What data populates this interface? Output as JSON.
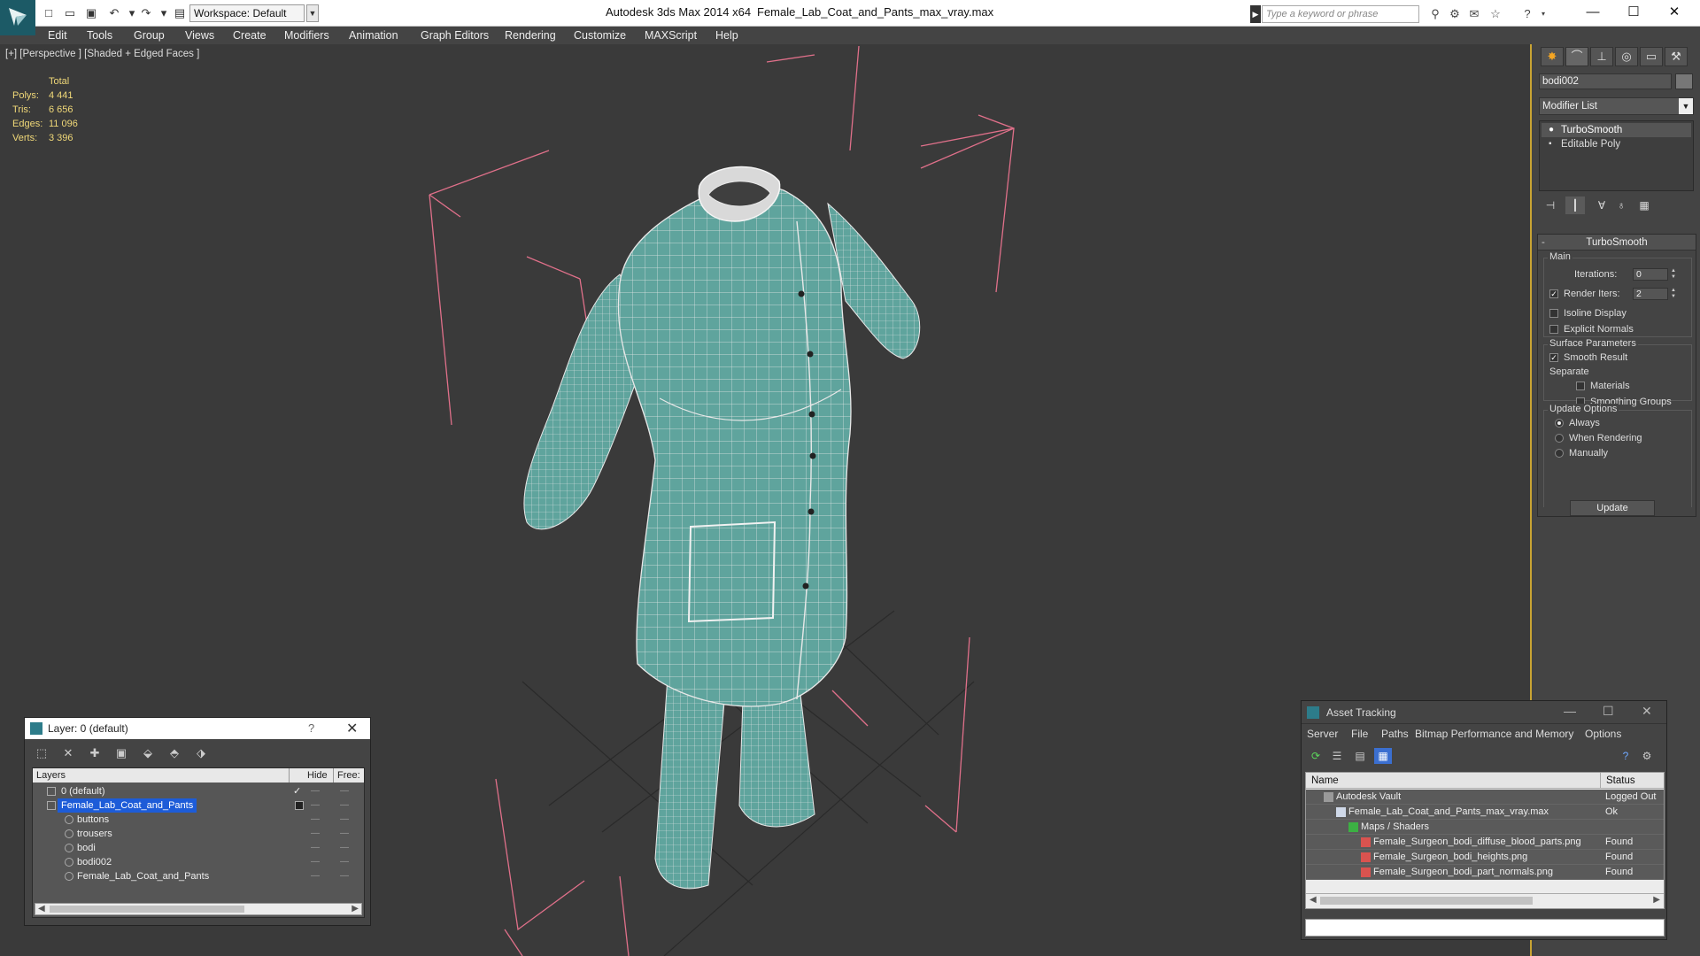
{
  "titlebar": {
    "workspace_label": "Workspace: Default",
    "app_title": "Autodesk 3ds Max  2014 x64",
    "file_title": "Female_Lab_Coat_and_Pants_max_vray.max",
    "search_placeholder": "Type a keyword or phrase"
  },
  "menu": [
    "Edit",
    "Tools",
    "Group",
    "Views",
    "Create",
    "Modifiers",
    "Animation",
    "Graph Editors",
    "Rendering",
    "Customize",
    "MAXScript",
    "Help"
  ],
  "viewport": {
    "label": "[+] [Perspective ] [Shaded + Edged Faces ]",
    "stats": {
      "header": "Total",
      "rows": [
        {
          "label": "Polys:",
          "value": "4 441"
        },
        {
          "label": "Tris:",
          "value": "6 656"
        },
        {
          "label": "Edges:",
          "value": "11 096"
        },
        {
          "label": "Verts:",
          "value": "3 396"
        }
      ]
    },
    "colors": {
      "mesh": "#5fa49d",
      "wire": "#e8e8e8",
      "bbox": "#e0708a",
      "grid": "#2c2c2c"
    }
  },
  "command_panel": {
    "object_name": "bodi002",
    "modifier_list": "Modifier List",
    "stack": [
      "TurboSmooth",
      "Editable Poly"
    ],
    "turbosmooth": {
      "title": "TurboSmooth",
      "main_label": "Main",
      "iterations_label": "Iterations:",
      "iterations_value": "0",
      "render_iters_label": "Render Iters:",
      "render_iters_value": "2",
      "render_iters_checked": true,
      "isoline_display": "Isoline Display",
      "explicit_normals": "Explicit Normals",
      "surface_params": "Surface Parameters",
      "smooth_result": "Smooth Result",
      "separate": "Separate",
      "materials": "Materials",
      "smoothing_groups": "Smoothing Groups",
      "update_options": "Update Options",
      "always": "Always",
      "when_rendering": "When Rendering",
      "manually": "Manually",
      "update_button": "Update"
    }
  },
  "layer_dialog": {
    "title": "Layer: 0 (default)",
    "help": "?",
    "columns": [
      "Layers",
      "Hide",
      "Free:"
    ],
    "rows": [
      {
        "name": "0 (default)",
        "indent": 0
      },
      {
        "name": "Female_Lab_Coat_and_Pants",
        "indent": 0
      },
      {
        "name": "buttons",
        "indent": 1
      },
      {
        "name": "trousers",
        "indent": 1
      },
      {
        "name": "bodi",
        "indent": 1
      },
      {
        "name": "bodi002",
        "indent": 1
      },
      {
        "name": "Female_Lab_Coat_and_Pants",
        "indent": 1
      }
    ]
  },
  "asset_tracking": {
    "title": "Asset Tracking",
    "menu": [
      "Server",
      "File",
      "Paths",
      "Bitmap Performance and Memory",
      "Options"
    ],
    "columns": [
      "Name",
      "Status"
    ],
    "rows": [
      {
        "name": "Autodesk Vault",
        "status": "Logged Out",
        "indent": 1
      },
      {
        "name": "Female_Lab_Coat_and_Pants_max_vray.max",
        "status": "Ok",
        "indent": 2
      },
      {
        "name": "Maps / Shaders",
        "status": "",
        "indent": 3
      },
      {
        "name": "Female_Surgeon_bodi_diffuse_blood_parts.png",
        "status": "Found",
        "indent": 4
      },
      {
        "name": "Female_Surgeon_bodi_heights.png",
        "status": "Found",
        "indent": 4
      },
      {
        "name": "Female_Surgeon_bodi_part_normals.png",
        "status": "Found",
        "indent": 4
      }
    ]
  }
}
